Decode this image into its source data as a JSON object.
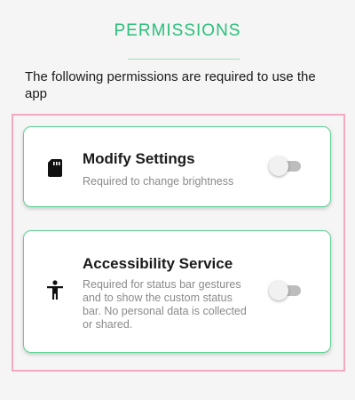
{
  "header": {
    "title": "PERMISSIONS"
  },
  "intro": {
    "text": "The following permissions are required to use the app"
  },
  "permissions": [
    {
      "icon": "sd-card-icon",
      "title": "Modify Settings",
      "description": "Required to change brightness",
      "enabled": false
    },
    {
      "icon": "accessibility-icon",
      "title": "Accessibility Service",
      "description": "Required for status bar gestures and to show the custom status bar. No personal data is collected or shared.",
      "enabled": false
    }
  ],
  "colors": {
    "accent": "#2bbf7a",
    "card_border": "#5fd395",
    "highlight_border": "#f3a9c4",
    "toggle_off_track": "#bdbdbd"
  }
}
